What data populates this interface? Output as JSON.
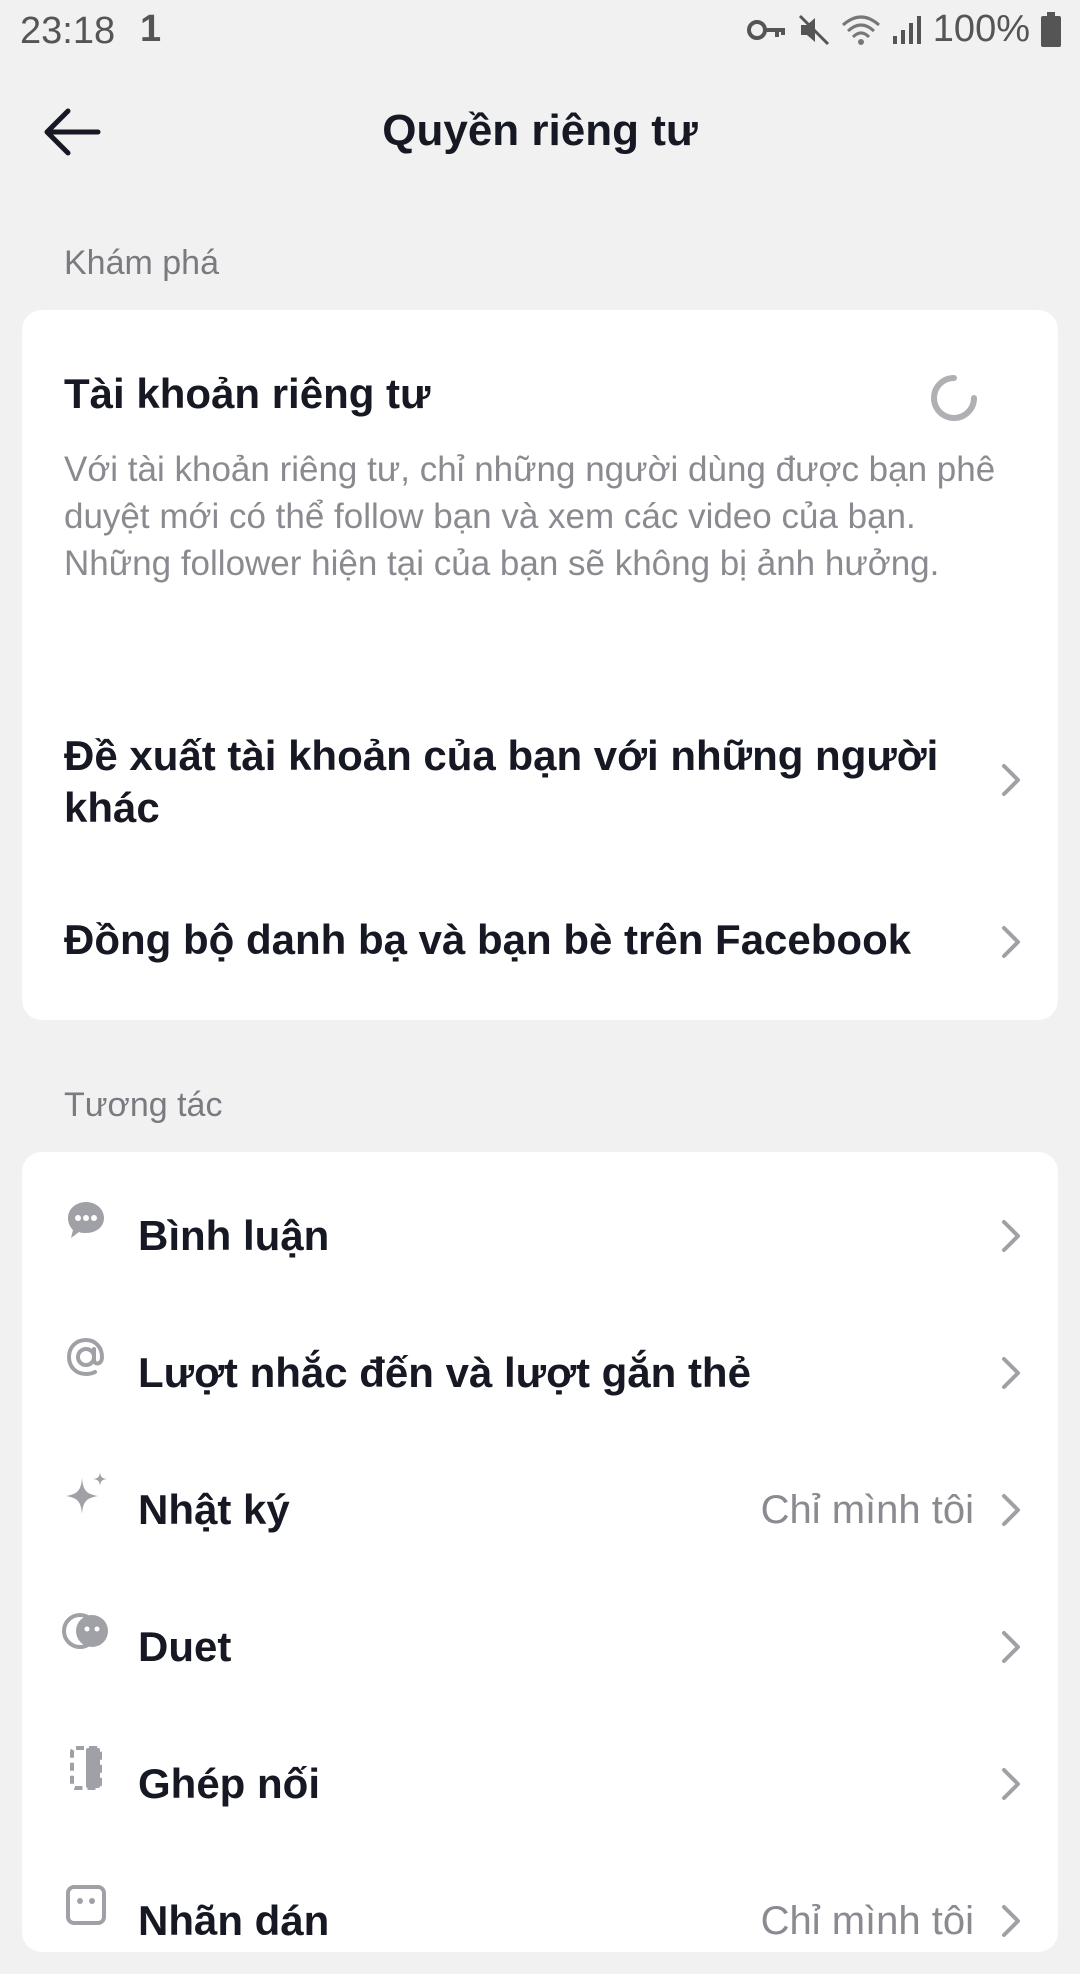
{
  "status_bar": {
    "time": "23:18",
    "notif": "1",
    "battery": "100%"
  },
  "header": {
    "title": "Quyền riêng tư"
  },
  "sections": {
    "explore": {
      "label": "Khám phá",
      "private_account": {
        "title": "Tài khoản riêng tư",
        "desc": "Với tài khoản riêng tư, chỉ những người dùng được bạn phê duyệt mới có thể follow bạn và xem các video của bạn. Những follower hiện tại của bạn sẽ không bị ảnh hưởng."
      },
      "suggest": {
        "title": "Đề xuất tài khoản của bạn với những người khác"
      },
      "sync": {
        "title": "Đồng bộ danh bạ và bạn bè trên Facebook"
      }
    },
    "interaction": {
      "label": "Tương tác",
      "items": [
        {
          "title": "Bình luận",
          "icon": "comment-icon",
          "value": ""
        },
        {
          "title": "Lượt nhắc đến và lượt gắn thẻ",
          "icon": "at-icon",
          "value": ""
        },
        {
          "title": "Nhật ký",
          "icon": "sparkle-icon",
          "value": "Chỉ mình tôi"
        },
        {
          "title": "Duet",
          "icon": "duet-icon",
          "value": ""
        },
        {
          "title": "Ghép nối",
          "icon": "stitch-icon",
          "value": ""
        },
        {
          "title": "Nhãn dán",
          "icon": "sticker-icon",
          "value": "Chỉ mình tôi"
        }
      ]
    }
  }
}
